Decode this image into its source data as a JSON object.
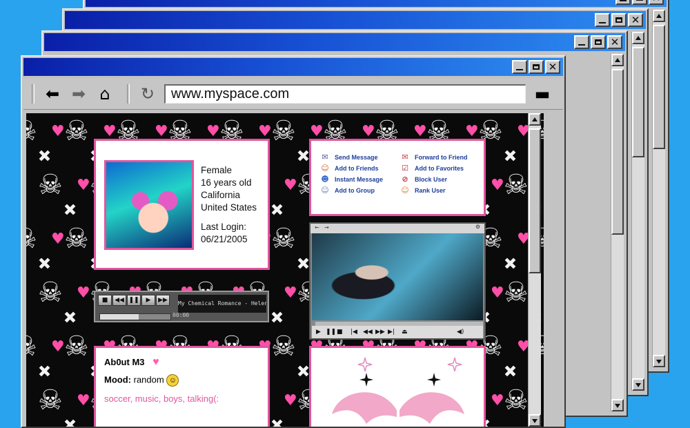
{
  "browser": {
    "address": "www.myspace.com",
    "accent_color": "#e0559e",
    "background_color": "#29a3ee"
  },
  "profile": {
    "gender": "Female",
    "age": "16 years old",
    "region": "California",
    "country": "United States",
    "last_login_label": "Last Login:",
    "last_login_date": "06/21/2005"
  },
  "contact": {
    "items": [
      {
        "label": "Send Message",
        "icon": "envelope-icon"
      },
      {
        "label": "Forward to Friend",
        "icon": "forward-envelope-icon"
      },
      {
        "label": "Add to Friends",
        "icon": "add-friend-icon"
      },
      {
        "label": "Add to Favorites",
        "icon": "favorite-icon"
      },
      {
        "label": "Instant Message",
        "icon": "chat-icon"
      },
      {
        "label": "Block User",
        "icon": "block-icon"
      },
      {
        "label": "Add to Group",
        "icon": "group-icon"
      },
      {
        "label": "Rank User",
        "icon": "rank-icon"
      }
    ]
  },
  "music_player": {
    "now_playing": "My Chemical Romance - Helena",
    "time": "00:00",
    "volume_fraction": 0.55
  },
  "video_player": {
    "progress_fraction": 0.02
  },
  "about": {
    "heading": "Ab0ut M3",
    "mood_label": "Mood:",
    "mood_value": "random",
    "interests": "soccer, music, boys, talking(:"
  }
}
